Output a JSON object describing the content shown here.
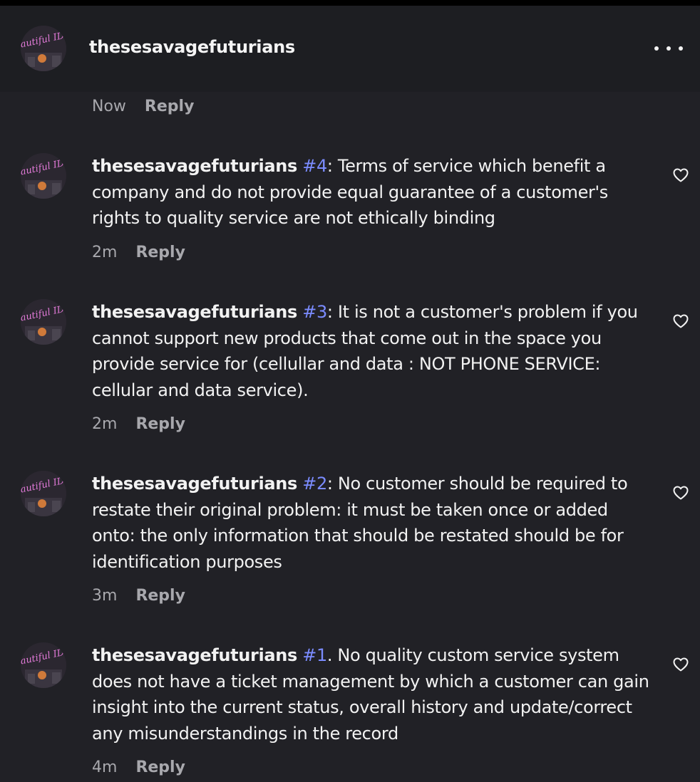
{
  "post": {
    "username": "thesesavagefuturians",
    "time": "Now",
    "reply_label": "Reply"
  },
  "comments": [
    {
      "username": "thesesavagefuturians",
      "tag": "#4",
      "text": ": Terms of service which benefit a company and do not provide equal guarantee of a customer's rights to quality service are not ethically binding",
      "time": "2m",
      "reply_label": "Reply"
    },
    {
      "username": "thesesavagefuturians",
      "tag": "#3",
      "text": ": It is not a customer's problem if you cannot support new products that come out in the space you provide service for (cellullar and data : NOT PHONE SERVICE: cellular and data service).",
      "time": "2m",
      "reply_label": "Reply"
    },
    {
      "username": "thesesavagefuturians",
      "tag": "#2",
      "text": ": No customer should be required to restate their original problem: it must be taken once or added onto: the only information that should be restated should be for identification purposes",
      "time": "3m",
      "reply_label": "Reply"
    },
    {
      "username": "thesesavagefuturians",
      "tag": "#1",
      "text": ". No quality custom service system does not have a ticket management by which a customer can gain insight into the current status, overall history and update/correct any misunderstandings in the record",
      "time": "4m",
      "reply_label": "Reply"
    }
  ],
  "avatar_text": "Beautiful IDEA",
  "icons": {
    "more": "more-options-icon",
    "like": "heart-icon"
  },
  "colors": {
    "background": "#212126",
    "header_background": "#1d1e22",
    "hashtag": "#7b8cff",
    "meta": "#a8a8ad"
  }
}
